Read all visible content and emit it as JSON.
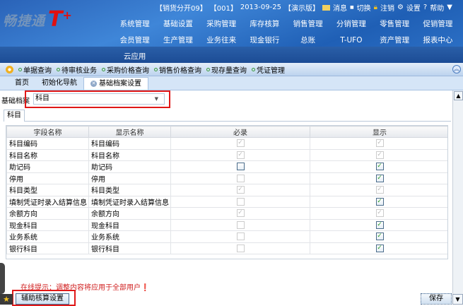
{
  "header": {
    "logo_text": "畅捷通",
    "logo_brand": "T",
    "logo_plus": "+",
    "account": "【销货分开09】",
    "code": "【001】",
    "date": "2013-09-25",
    "edition": "【演示版】",
    "actions": [
      "消息",
      "切换",
      "注销",
      "设置",
      "帮助"
    ],
    "menu": [
      "系统管理",
      "基础设置",
      "采购管理",
      "库存核算",
      "销售管理",
      "分销管理",
      "零售管理",
      "促销管理",
      "会员管理",
      "生产管理",
      "业务往来",
      "现金银行",
      "总账",
      "T-UFO",
      "资产管理",
      "报表中心",
      "云应用"
    ]
  },
  "toolbar": {
    "links": [
      "单据查询",
      "待审核业务",
      "采购价格查询",
      "销售价格查询",
      "现存量查询",
      "凭证管理"
    ]
  },
  "tabs": [
    {
      "label": "首页",
      "active": false
    },
    {
      "label": "初始化导航",
      "active": false
    },
    {
      "label": "基础档案设置",
      "active": true
    }
  ],
  "form": {
    "label": "基础档案",
    "selected": "科目",
    "subtab": "科目"
  },
  "table": {
    "columns": [
      "字段名称",
      "显示名称",
      "必录",
      "显示"
    ],
    "rows": [
      {
        "field": "科目编码",
        "display": "科目编码",
        "required": true,
        "required_enabled": false,
        "shown": true,
        "shown_enabled": false
      },
      {
        "field": "科目名称",
        "display": "科目名称",
        "required": true,
        "required_enabled": false,
        "shown": true,
        "shown_enabled": false
      },
      {
        "field": "助记码",
        "display": "助记码",
        "required": false,
        "required_enabled": true,
        "shown": true,
        "shown_enabled": true
      },
      {
        "field": "停用",
        "display": "停用",
        "required": false,
        "required_enabled": false,
        "shown": true,
        "shown_enabled": true
      },
      {
        "field": "科目类型",
        "display": "科目类型",
        "required": true,
        "required_enabled": false,
        "shown": true,
        "shown_enabled": false
      },
      {
        "field": "填制凭证时录入结算信息",
        "display": "填制凭证时录入结算信息",
        "required": false,
        "required_enabled": false,
        "shown": true,
        "shown_enabled": true
      },
      {
        "field": "余额方向",
        "display": "余额方向",
        "required": true,
        "required_enabled": false,
        "shown": true,
        "shown_enabled": false
      },
      {
        "field": "现金科目",
        "display": "现金科目",
        "required": false,
        "required_enabled": false,
        "shown": true,
        "shown_enabled": true
      },
      {
        "field": "业务系统",
        "display": "业务系统",
        "required": false,
        "required_enabled": false,
        "shown": true,
        "shown_enabled": true
      },
      {
        "field": "银行科目",
        "display": "银行科目",
        "required": false,
        "required_enabled": false,
        "shown": true,
        "shown_enabled": true
      }
    ]
  },
  "footer": {
    "hint": "在线提示：调整内容将应用于全部用户❗",
    "aux_button": "辅助核算设置",
    "save_button": "保存"
  },
  "colors": {
    "header_blue": "#2f73c8",
    "highlight_red": "#e01818",
    "hint_red": "#d02020",
    "check_green": "#2a9a2a"
  }
}
